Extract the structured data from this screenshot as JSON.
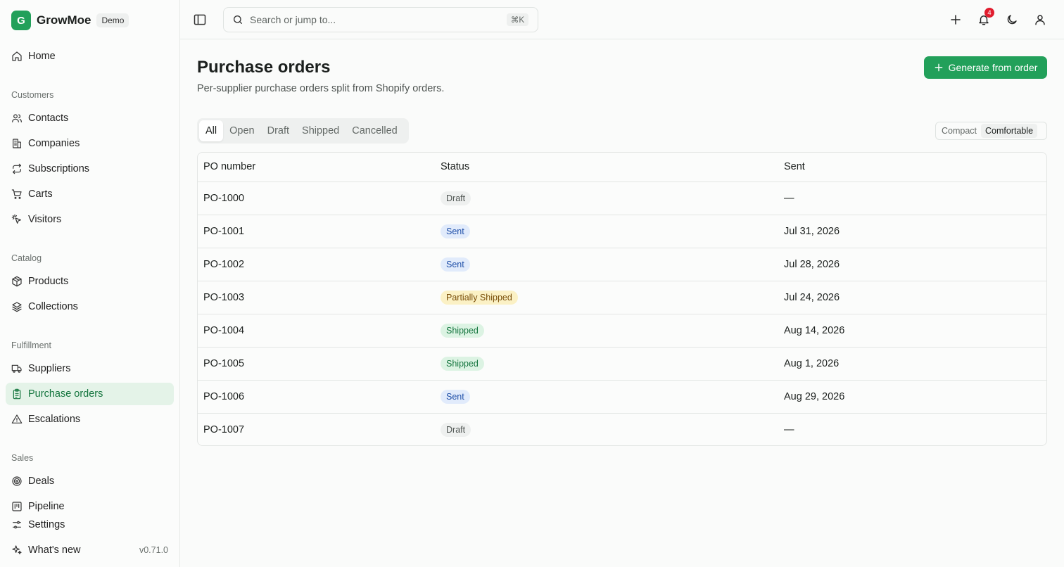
{
  "brand": {
    "logo_letter": "G",
    "name": "GrowMoe",
    "badge": "Demo",
    "accent": "#22a05a"
  },
  "sidebar": {
    "home": "Home",
    "sections": {
      "customers": "Customers",
      "catalog": "Catalog",
      "fulfillment": "Fulfillment",
      "sales": "Sales"
    },
    "items": {
      "contacts": "Contacts",
      "companies": "Companies",
      "subscriptions": "Subscriptions",
      "carts": "Carts",
      "visitors": "Visitors",
      "products": "Products",
      "collections": "Collections",
      "suppliers": "Suppliers",
      "purchase_orders": "Purchase orders",
      "escalations": "Escalations",
      "deals": "Deals",
      "pipeline": "Pipeline"
    },
    "footer": {
      "settings": "Settings",
      "whats_new": "What's new",
      "version": "v0.71.0"
    }
  },
  "topbar": {
    "search_placeholder": "Search or jump to...",
    "search_shortcut": "⌘K",
    "notification_count": "4"
  },
  "page": {
    "title": "Purchase orders",
    "subtitle": "Per-supplier purchase orders split from Shopify orders.",
    "primary_action": "Generate from order"
  },
  "filters": {
    "tabs": [
      "All",
      "Open",
      "Draft",
      "Shipped",
      "Cancelled"
    ],
    "selected_tab": "All"
  },
  "density": {
    "options": [
      "Compact",
      "Comfortable"
    ],
    "selected": "Comfortable"
  },
  "table": {
    "columns": [
      "PO number",
      "Status",
      "Sent"
    ],
    "rows": [
      {
        "po": "PO-1000",
        "status": "Draft",
        "sent": "—"
      },
      {
        "po": "PO-1001",
        "status": "Sent",
        "sent": "Jul 31, 2026"
      },
      {
        "po": "PO-1002",
        "status": "Sent",
        "sent": "Jul 28, 2026"
      },
      {
        "po": "PO-1003",
        "status": "Partially Shipped",
        "sent": "Jul 24, 2026"
      },
      {
        "po": "PO-1004",
        "status": "Shipped",
        "sent": "Aug 14, 2026"
      },
      {
        "po": "PO-1005",
        "status": "Shipped",
        "sent": "Aug 1, 2026"
      },
      {
        "po": "PO-1006",
        "status": "Sent",
        "sent": "Aug 29, 2026"
      },
      {
        "po": "PO-1007",
        "status": "Draft",
        "sent": "—"
      }
    ]
  }
}
